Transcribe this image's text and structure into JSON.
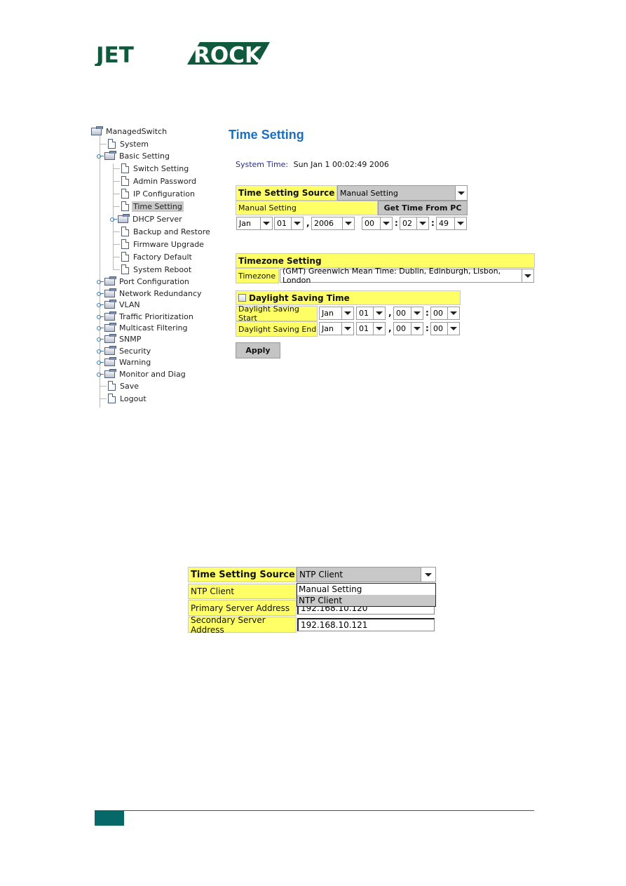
{
  "brand": {
    "logo_text_left": "JET",
    "logo_text_right": "ROCK",
    "color": "#0f5a3c"
  },
  "tree": {
    "root": "ManagedSwitch",
    "items": [
      {
        "label": "System",
        "type": "doc"
      },
      {
        "label": "Basic Setting",
        "type": "folder",
        "expanded": true
      },
      {
        "label": "Switch Setting",
        "type": "doc"
      },
      {
        "label": "Admin Password",
        "type": "doc"
      },
      {
        "label": "IP Configuration",
        "type": "doc"
      },
      {
        "label": "Time Setting",
        "type": "doc",
        "selected": true
      },
      {
        "label": "DHCP Server",
        "type": "folder"
      },
      {
        "label": "Backup and Restore",
        "type": "doc"
      },
      {
        "label": "Firmware Upgrade",
        "type": "doc"
      },
      {
        "label": "Factory Default",
        "type": "doc"
      },
      {
        "label": "System Reboot",
        "type": "doc"
      },
      {
        "label": "Port Configuration",
        "type": "folder"
      },
      {
        "label": "Network Redundancy",
        "type": "folder"
      },
      {
        "label": "VLAN",
        "type": "folder"
      },
      {
        "label": "Traffic Prioritization",
        "type": "folder"
      },
      {
        "label": "Multicast Filtering",
        "type": "folder"
      },
      {
        "label": "SNMP",
        "type": "folder"
      },
      {
        "label": "Security",
        "type": "folder"
      },
      {
        "label": "Warning",
        "type": "folder"
      },
      {
        "label": "Monitor and Diag",
        "type": "folder"
      },
      {
        "label": "Save",
        "type": "doc"
      },
      {
        "label": "Logout",
        "type": "doc"
      }
    ]
  },
  "page": {
    "title": "Time Setting",
    "system_time_label": "System Time:",
    "system_time_value": "Sun Jan 1 00:02:49 2006"
  },
  "time_source": {
    "label": "Time Setting Source",
    "value": "Manual Setting",
    "manual_label": "Manual Setting",
    "get_time_button": "Get Time From PC",
    "month": "Jan",
    "day": "01",
    "year": "2006",
    "hour": "00",
    "minute": "02",
    "second": "49",
    "comma": ",",
    "colon": ":"
  },
  "timezone": {
    "header": "Timezone Setting",
    "label": "Timezone",
    "value": "(GMT) Greenwich Mean Time: Dublin, Edinburgh, Lisbon, London"
  },
  "dst": {
    "header": "Daylight Saving Time",
    "checked": false,
    "start_label": "Daylight Saving Start",
    "end_label": "Daylight Saving End",
    "start": {
      "month": "Jan",
      "day": "01",
      "hour": "00",
      "minute": "00"
    },
    "end": {
      "month": "Jan",
      "day": "01",
      "hour": "00",
      "minute": "00"
    }
  },
  "apply_button": "Apply",
  "ntp_panel": {
    "source_label": "Time Setting Source",
    "source_value": "NTP Client",
    "ntp_client_label": "NTP Client",
    "primary_label": "Primary Server Address",
    "primary_value": "192.168.10.120",
    "secondary_label": "Secondary Server Address",
    "secondary_value": "192.168.10.121",
    "dropdown_options": [
      "Manual Setting",
      "NTP Client"
    ],
    "dropdown_active": "NTP Client"
  }
}
